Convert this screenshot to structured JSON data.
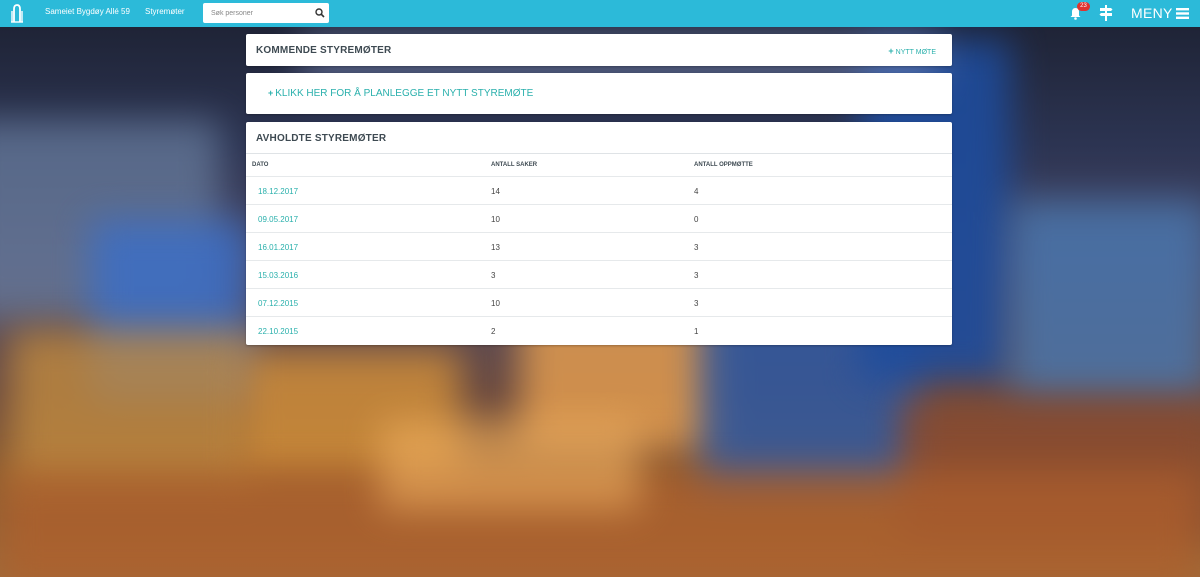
{
  "topbar": {
    "property_name": "Sameiet Bygdøy Allé 59",
    "section": "Styremøter",
    "search_placeholder": "Søk personer",
    "notification_count": "23",
    "menu_label": "MENY",
    "background_color": "#2cbad9"
  },
  "upcoming": {
    "title": "KOMMENDE STYREMØTER",
    "new_meeting_label": "NYTT MØTE",
    "plan_link": "KLIKK HER FOR Å PLANLEGGE ET NYTT STYREMØTE"
  },
  "held": {
    "title": "AVHOLDTE STYREMØTER",
    "columns": [
      "DATO",
      "ANTALL SAKER",
      "ANTALL OPPMØTTE"
    ],
    "rows": [
      {
        "date": "18.12.2017",
        "cases": "14",
        "attendees": "4"
      },
      {
        "date": "09.05.2017",
        "cases": "10",
        "attendees": "0"
      },
      {
        "date": "16.01.2017",
        "cases": "13",
        "attendees": "3"
      },
      {
        "date": "15.03.2016",
        "cases": "3",
        "attendees": "3"
      },
      {
        "date": "07.12.2015",
        "cases": "10",
        "attendees": "3"
      },
      {
        "date": "22.10.2015",
        "cases": "2",
        "attendees": "1"
      }
    ]
  },
  "colors": {
    "accent": "#2ab0ac",
    "heading": "#3e4a52",
    "badge": "#e0332e"
  }
}
